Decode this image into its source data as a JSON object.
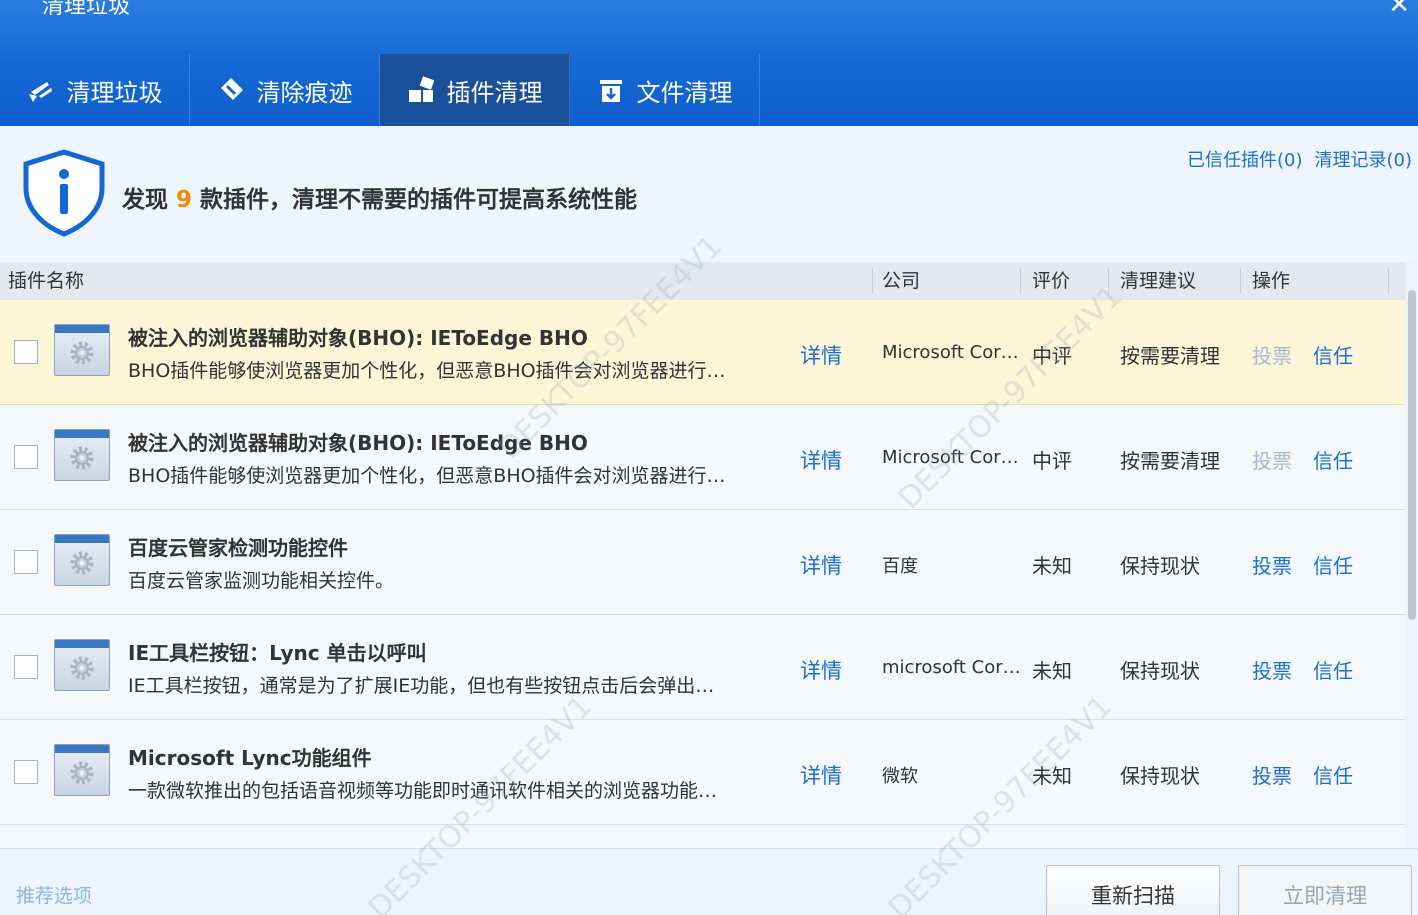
{
  "window": {
    "title": "清理垃圾",
    "close_glyph": "✕"
  },
  "tabs": [
    {
      "label": "清理垃圾",
      "icon": "broom-icon"
    },
    {
      "label": "清除痕迹",
      "icon": "eraser-icon"
    },
    {
      "label": "插件清理",
      "icon": "plugin-icon",
      "active": true
    },
    {
      "label": "文件清理",
      "icon": "trash-icon"
    }
  ],
  "info": {
    "prefix": "发现",
    "count": "9",
    "suffix": "款插件，清理不需要的插件可提高系统性能",
    "trusted_link": "已信任插件(0)",
    "history_link": "清理记录(0)"
  },
  "table": {
    "columns": {
      "name": "插件名称",
      "company": "公司",
      "rating": "评价",
      "advice": "清理建议",
      "action": "操作"
    },
    "detail_label": "详情",
    "vote_label": "投票",
    "trust_label": "信任",
    "rows": [
      {
        "name": "被注入的浏览器辅助对象(BHO): IEToEdge BHO",
        "desc": "BHO插件能够使浏览器更加个性化，但恶意BHO插件会对浏览器进行…",
        "company": "Microsoft Cor…",
        "rating": "中评",
        "advice": "按需要清理"
      },
      {
        "name": "被注入的浏览器辅助对象(BHO): IEToEdge BHO",
        "desc": "BHO插件能够使浏览器更加个性化，但恶意BHO插件会对浏览器进行…",
        "company": "Microsoft Cor…",
        "rating": "中评",
        "advice": "按需要清理"
      },
      {
        "name": "百度云管家检测功能控件",
        "desc": "百度云管家监测功能相关控件。",
        "company": "百度",
        "rating": "未知",
        "advice": "保持现状"
      },
      {
        "name": "IE工具栏按钮：Lync 单击以呼叫",
        "desc": "IE工具栏按钮，通常是为了扩展IE功能，但也有些按钮点击后会弹出…",
        "company": "microsoft Cor…",
        "rating": "未知",
        "advice": "保持现状"
      },
      {
        "name": "Microsoft Lync功能组件",
        "desc": "一款微软推出的包括语音视频等功能即时通讯软件相关的浏览器功能…",
        "company": "微软",
        "rating": "未知",
        "advice": "保持现状"
      }
    ]
  },
  "footer": {
    "recommend": "推荐选项",
    "rescan": "重新扫描",
    "clean_now": "立即清理"
  },
  "watermark": "DESKTOP-97FEE4V1",
  "colors": {
    "header_blue": "#1467d3",
    "active_tab": "#1a4f9a",
    "link_blue": "#1b6fd1",
    "count_orange": "#f08a00",
    "highlight_row": "#fdf5d8"
  }
}
